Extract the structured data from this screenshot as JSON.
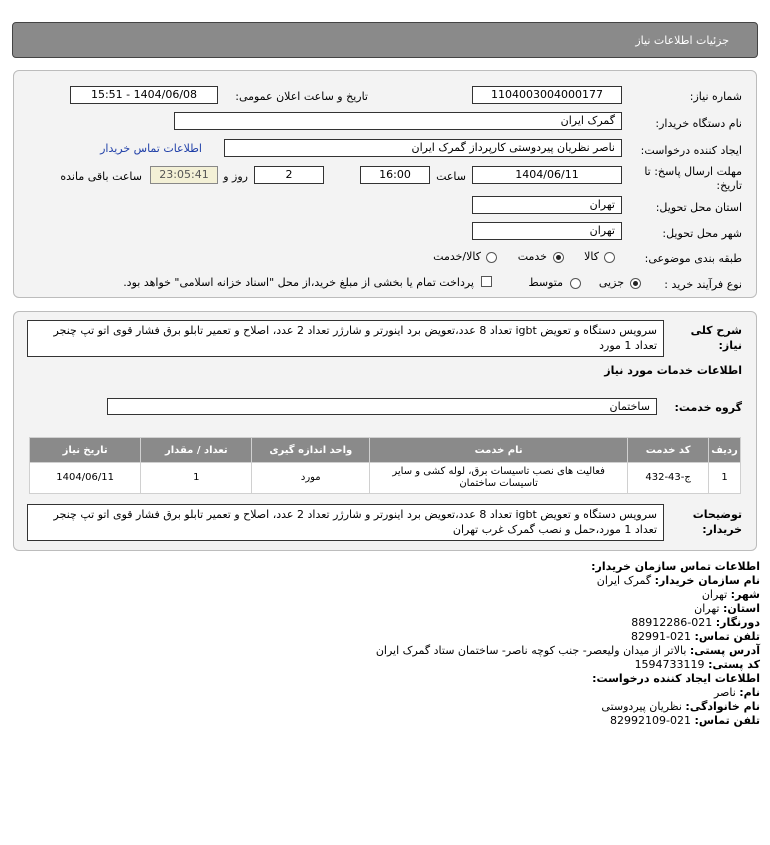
{
  "header": {
    "title": "جزئیات اطلاعات نیاز"
  },
  "form": {
    "need_number_label": "شماره نیاز:",
    "need_number": "1104003004000177",
    "announce_label": "تاریخ و ساعت اعلان عمومی:",
    "announce_value": "1404/06/08 - 15:51",
    "buyer_org_label": "نام دستگاه خریدار:",
    "buyer_org": "گمرک ایران",
    "requester_label": "ایجاد کننده درخواست:",
    "requester": "ناصر نظریان پیردوستی کارپرداز گمرک ایران",
    "contact_link": "اطلاعات تماس خریدار",
    "deadline_label_1": "مهلت ارسال پاسخ: تا",
    "deadline_label_2": "تاریخ:",
    "deadline_date": "1404/06/11",
    "time_label": "ساعت",
    "deadline_time": "16:00",
    "days_value": "2",
    "days_label": "روز و",
    "remaining_time": "23:05:41",
    "remaining_label": "ساعت باقی مانده",
    "province_label": "استان محل تحویل:",
    "province": "تهران",
    "city_label": "شهر محل تحویل:",
    "city": "تهران",
    "category_label": "طبقه بندی موضوعی:",
    "category_options": [
      "کالا",
      "خدمت",
      "کالا/خدمت"
    ],
    "category_selected": "خدمت",
    "process_label": "نوع فرآیند خرید :",
    "process_options": [
      "جزیی",
      "متوسط"
    ],
    "process_selected": "جزیی",
    "payment_note": "پرداخت تمام یا بخشی از مبلغ خرید،از محل \"اسناد خزانه اسلامی\" خواهد بود."
  },
  "description": {
    "label_1": "شرح کلی",
    "label_2": "نیاز:",
    "text": "سرویس دستگاه و تعویض igbt تعداد 8 عدد،تعویض برد اینورتر و شارژر تعداد 2 عدد، اصلاح و تعمیر تابلو برق فشار قوی اتو تپ چنجر تعداد 1 مورد"
  },
  "services": {
    "section_title": "اطلاعات خدمات مورد نیاز",
    "group_label": "گروه خدمت:",
    "group_value": "ساختمان",
    "columns": [
      "ردیف",
      "کد خدمت",
      "نام خدمت",
      "واحد اندازه گیری",
      "تعداد / مقدار",
      "تاریخ نیاز"
    ],
    "rows": [
      {
        "row": "1",
        "code": "ج-43-432",
        "name": "فعالیت های نصب تاسیسات برق، لوله کشی و سایر تاسیسات ساختمان",
        "unit": "مورد",
        "qty": "1",
        "date": "1404/06/11"
      }
    ]
  },
  "buyer_notes": {
    "label_1": "توضیحات",
    "label_2": "خریدار:",
    "text": "سرویس دستگاه و تعویض igbt تعداد 8 عدد،تعویض برد اینورتر و شارژر تعداد 2 عدد، اصلاح و تعمیر تابلو برق فشار قوی اتو تپ چنجر تعداد 1 مورد،حمل و نصب گمرک غرب تهران"
  },
  "contact": {
    "title": "اطلاعات تماس سازمان خریدار:",
    "org_label": "نام سازمان خریدار:",
    "org": "گمرک ایران",
    "city_label": "شهر:",
    "city": "تهران",
    "province_label": "استان:",
    "province": "تهران",
    "fax_label": "دورنگار:",
    "fax": "021-88912286",
    "phone_label": "تلفن تماس:",
    "phone": "021-82991",
    "address_label": "آدرس پستی:",
    "address": "بالاتر از میدان ولیعصر- جنب کوچه ناصر- ساختمان ستاد گمرک ایران",
    "postal_label": "کد پستی:",
    "postal": "1594733119",
    "creator_title": "اطلاعات ایجاد کننده درخواست:",
    "first_name_label": "نام:",
    "first_name": "ناصر",
    "last_name_label": "نام خانوادگی:",
    "last_name": "نظریان پیردوستی",
    "creator_phone_label": "تلفن تماس:",
    "creator_phone": "021-82992109"
  }
}
